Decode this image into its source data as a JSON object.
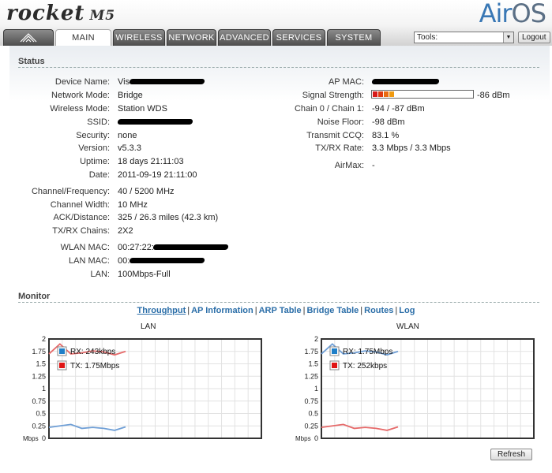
{
  "brand": {
    "name": "rocket",
    "model": "M5",
    "product_a": "Air",
    "product_b": "OS"
  },
  "tabs": [
    {
      "label": "",
      "icon": "ubiquiti-logo-icon"
    },
    {
      "label": "MAIN"
    },
    {
      "label": "WIRELESS"
    },
    {
      "label": "NETWORK"
    },
    {
      "label": "ADVANCED"
    },
    {
      "label": "SERVICES"
    },
    {
      "label": "SYSTEM"
    }
  ],
  "tools": {
    "selected": "Tools:"
  },
  "logout_label": "Logout",
  "status": {
    "title": "Status",
    "left": [
      {
        "label": "Device Name:",
        "value": "Vis",
        "redacted": true
      },
      {
        "label": "Network Mode:",
        "value": "Bridge"
      },
      {
        "label": "Wireless Mode:",
        "value": "Station WDS"
      },
      {
        "label": "SSID:",
        "value": "",
        "redacted": true
      },
      {
        "label": "Security:",
        "value": "none"
      },
      {
        "label": "Version:",
        "value": "v5.3.3"
      },
      {
        "label": "Uptime:",
        "value": "18 days 21:11:03"
      },
      {
        "label": "Date:",
        "value": "2011-09-19 21:11:00"
      },
      {
        "label": "Channel/Frequency:",
        "value": "40 / 5200 MHz"
      },
      {
        "label": "Channel Width:",
        "value": "10 MHz"
      },
      {
        "label": "ACK/Distance:",
        "value": "325 / 26.3 miles (42.3 km)"
      },
      {
        "label": "TX/RX Chains:",
        "value": "2X2"
      },
      {
        "label": "WLAN MAC:",
        "value": "00:27:22:",
        "redacted": true
      },
      {
        "label": "LAN MAC:",
        "value": "00:",
        "redacted": true
      },
      {
        "label": "LAN:",
        "value": "100Mbps-Full"
      }
    ],
    "right": [
      {
        "label": "AP MAC:",
        "value": "",
        "redacted": true
      },
      {
        "label": "Signal Strength:",
        "value": "-86 dBm"
      },
      {
        "label": "Chain 0 / Chain 1:",
        "value": "-94 / -87 dBm"
      },
      {
        "label": "Noise Floor:",
        "value": "-98 dBm"
      },
      {
        "label": "Transmit CCQ:",
        "value": "83.1 %"
      },
      {
        "label": "TX/RX Rate:",
        "value": "3.3 Mbps / 3.3 Mbps"
      },
      {
        "label": "AirMax:",
        "value": "-"
      }
    ],
    "signal_level_fraction": 0.33
  },
  "monitor": {
    "title": "Monitor",
    "links": [
      "Throughput",
      "AP Information",
      "ARP Table",
      "Bridge Table",
      "Routes",
      "Log"
    ],
    "refresh_label": "Refresh"
  },
  "colors": {
    "rx": "#6f9fd6",
    "tx": "#e66a6a",
    "rx_legend": "#1f7fc8",
    "tx_legend": "#e01515",
    "link": "#2b6ea8"
  },
  "chart_data": [
    {
      "type": "line",
      "title": "LAN",
      "ylabel": "Mbps",
      "ylim": [
        0,
        2
      ],
      "yticks": [
        "0",
        "0.25",
        "0.5",
        "0.75",
        "1",
        "1.25",
        "1.5",
        "1.75",
        "2"
      ],
      "legend_position": "top-left",
      "grid": true,
      "series": [
        {
          "name": "RX: 243kbps",
          "values": [
            0.22,
            0.25,
            0.28,
            0.2,
            0.22,
            0.2,
            0.16,
            0.23
          ]
        },
        {
          "name": "TX: 1.75Mbps",
          "values": [
            1.7,
            1.9,
            1.7,
            1.72,
            1.76,
            1.74,
            1.68,
            1.75
          ]
        }
      ]
    },
    {
      "type": "line",
      "title": "WLAN",
      "ylabel": "Mbps",
      "ylim": [
        0,
        2
      ],
      "yticks": [
        "0",
        "0.25",
        "0.5",
        "0.75",
        "1",
        "1.25",
        "1.5",
        "1.75",
        "2"
      ],
      "legend_position": "top-left",
      "grid": true,
      "series": [
        {
          "name": "RX: 1.75Mbps",
          "values": [
            1.7,
            1.9,
            1.7,
            1.72,
            1.76,
            1.74,
            1.68,
            1.75
          ]
        },
        {
          "name": "TX: 252kbps",
          "values": [
            0.22,
            0.25,
            0.28,
            0.2,
            0.22,
            0.2,
            0.16,
            0.23
          ]
        }
      ]
    }
  ]
}
